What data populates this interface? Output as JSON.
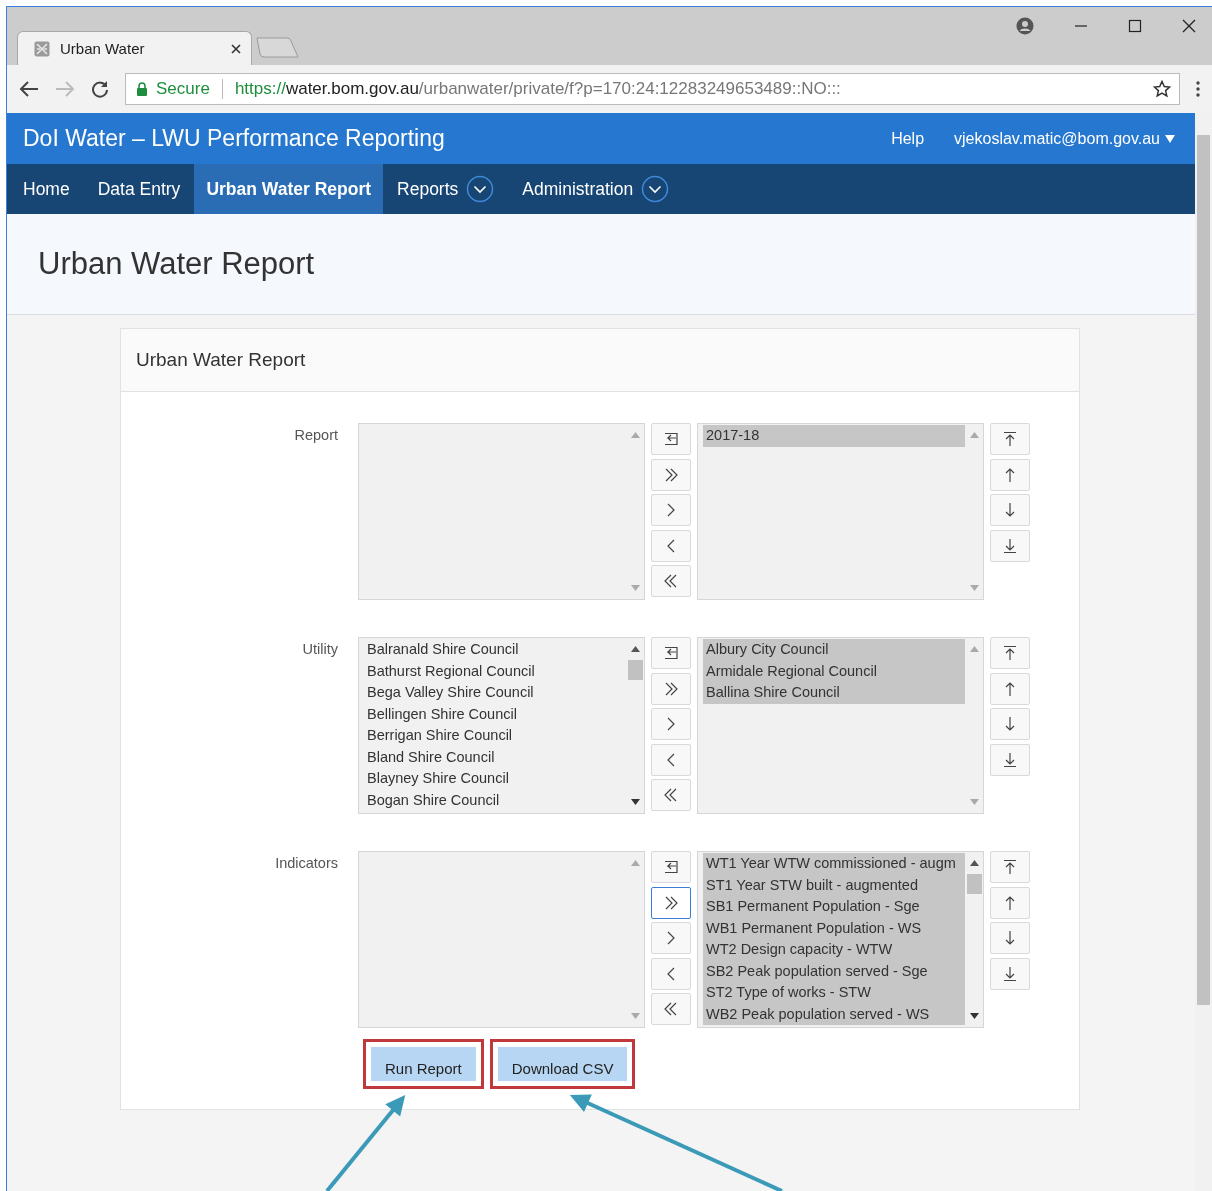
{
  "browser": {
    "tab": {
      "title": "Urban Water"
    },
    "address": {
      "secure_label": "Secure",
      "scheme": "https://",
      "host": "water.bom.gov.au",
      "path": "/urbanwater/private/f?p=170:24:12283249653489::NO:::"
    }
  },
  "header": {
    "title": "DoI Water – LWU Performance Reporting",
    "help": "Help",
    "user": "vjekoslav.matic@bom.gov.au"
  },
  "nav": [
    {
      "label": "Home",
      "selected": false,
      "has_menu": false
    },
    {
      "label": "Data Entry",
      "selected": false,
      "has_menu": false
    },
    {
      "label": "Urban Water Report",
      "selected": true,
      "has_menu": false
    },
    {
      "label": "Reports",
      "selected": false,
      "has_menu": true
    },
    {
      "label": "Administration",
      "selected": false,
      "has_menu": true
    }
  ],
  "page_title": "Urban Water Report",
  "region": {
    "title": "Urban Water Report",
    "shuttles": [
      {
        "label": "Report",
        "move_all_focused": false,
        "available": {
          "scrollable": false
        },
        "chosen": {
          "scrollable": false,
          "items": [
            {
              "text": "2017-18",
              "selected": true
            }
          ]
        }
      },
      {
        "label": "Utility",
        "move_all_focused": false,
        "available": {
          "scrollable": true,
          "items": [
            {
              "text": "Balranald Shire Council",
              "selected": false
            },
            {
              "text": "Bathurst Regional Council",
              "selected": false
            },
            {
              "text": "Bega Valley Shire Council",
              "selected": false
            },
            {
              "text": "Bellingen Shire Council",
              "selected": false
            },
            {
              "text": "Berrigan Shire Council",
              "selected": false
            },
            {
              "text": "Bland Shire Council",
              "selected": false
            },
            {
              "text": "Blayney Shire Council",
              "selected": false
            },
            {
              "text": "Bogan Shire Council",
              "selected": false
            }
          ]
        },
        "chosen": {
          "scrollable": false,
          "items": [
            {
              "text": "Albury City Council",
              "selected": true
            },
            {
              "text": "Armidale Regional Council",
              "selected": true
            },
            {
              "text": "Ballina Shire Council",
              "selected": true
            }
          ]
        }
      },
      {
        "label": "Indicators",
        "move_all_focused": true,
        "available": {
          "scrollable": false
        },
        "chosen": {
          "scrollable": true,
          "items": [
            {
              "text": "WT1 Year WTW commissioned - augm",
              "selected": true
            },
            {
              "text": "ST1 Year STW built - augmented",
              "selected": true
            },
            {
              "text": "SB1 Permanent Population - Sge",
              "selected": true
            },
            {
              "text": "WB1 Permanent Population - WS",
              "selected": true
            },
            {
              "text": "WT2 Design capacity - WTW",
              "selected": true
            },
            {
              "text": "SB2 Peak population served - Sge",
              "selected": true
            },
            {
              "text": "ST2 Type of works - STW",
              "selected": true
            },
            {
              "text": "WB2 Peak population served - WS",
              "selected": true
            }
          ]
        }
      }
    ],
    "buttons": [
      {
        "label": "Run Report",
        "highlighted": true,
        "arrow": true
      },
      {
        "label": "Download CSV",
        "highlighted": true,
        "arrow": true
      }
    ]
  }
}
